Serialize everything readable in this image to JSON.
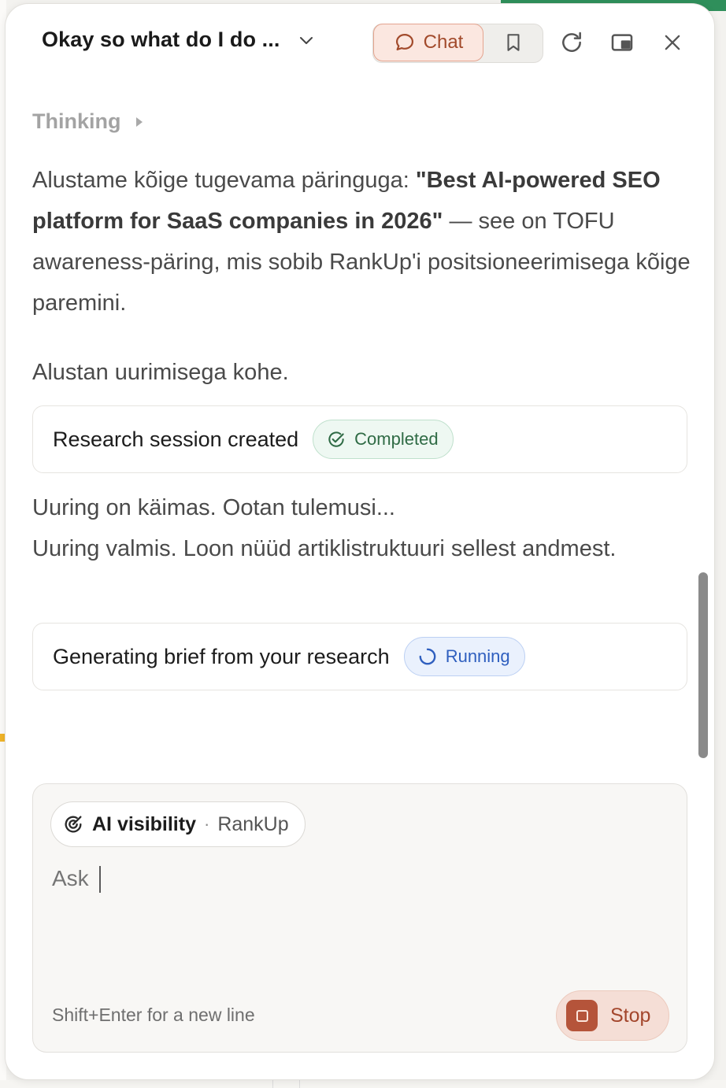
{
  "header": {
    "title": "Okay so what do I do ...",
    "chat_label": "Chat"
  },
  "messages": {
    "thinking_label": "Thinking",
    "para1_pre": "Alustame kõige tugevama päringuga: ",
    "para1_bold": "\"Best AI-powered SEO platform for SaaS companies in 2026\"",
    "para1_post": " — see on TOFU awareness-päring, mis sobib RankUp'i positsioneerimisega kõige paremini.",
    "para2": "Alustan uurimisega kohe.",
    "para3_line1": "Uuring on käimas. Ootan tulemusi...",
    "para3_line2": "Uuring valmis. Loon nüüd artiklistruktuuri sellest andmest."
  },
  "tools": [
    {
      "label": "Research session created",
      "status": "Completed"
    },
    {
      "label": "Generating brief from your research",
      "status": "Running"
    }
  ],
  "composer": {
    "chip_main": "AI visibility",
    "chip_sep": "·",
    "chip_sub": "RankUp",
    "placeholder": "Ask",
    "hint": "Shift+Enter for a new line",
    "stop_label": "Stop"
  },
  "colors": {
    "accent": "#a24a2b",
    "completed": "#2f6b45",
    "running": "#2f5fbf"
  },
  "icons": [
    "chevron-down-icon",
    "chat-bubble-icon",
    "bookmark-icon",
    "refresh-icon",
    "picture-in-picture-icon",
    "close-icon",
    "caret-right-icon",
    "check-circle-icon",
    "spinner-icon",
    "target-icon",
    "stop-icon"
  ]
}
